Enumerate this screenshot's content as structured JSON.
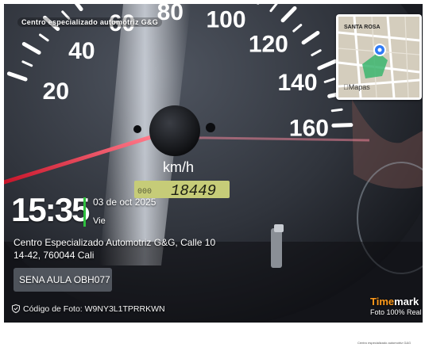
{
  "brand_caption": "Centro especializado automotriz G&G",
  "speedo": {
    "numbers": [
      "20",
      "40",
      "60",
      "80",
      "100",
      "120",
      "140",
      "160"
    ],
    "unit": "km/h",
    "odometer": "18449",
    "odometer_label": "000"
  },
  "stamp": {
    "time": "15:35",
    "date": "03 de oct 2025",
    "weekday": "Vie",
    "address": "Centro Especializado Automotriz G&G, Calle 10 14-42, 760044 Cali",
    "tag": "SENA AULA OBH077",
    "code": "Código de Foto: W9NY3L1TPRRKWN"
  },
  "map": {
    "label": "SANTA ROSA",
    "brand": "Mapas",
    "accent": "#2f7bf5",
    "zone": "#3bb56e"
  },
  "timemark": {
    "brand_a": "Time",
    "brand_b": "mark",
    "sub": "Foto 100% Real",
    "accent": "#ff9a1a"
  },
  "footer_note": "Centro especializado automotriz G&G"
}
